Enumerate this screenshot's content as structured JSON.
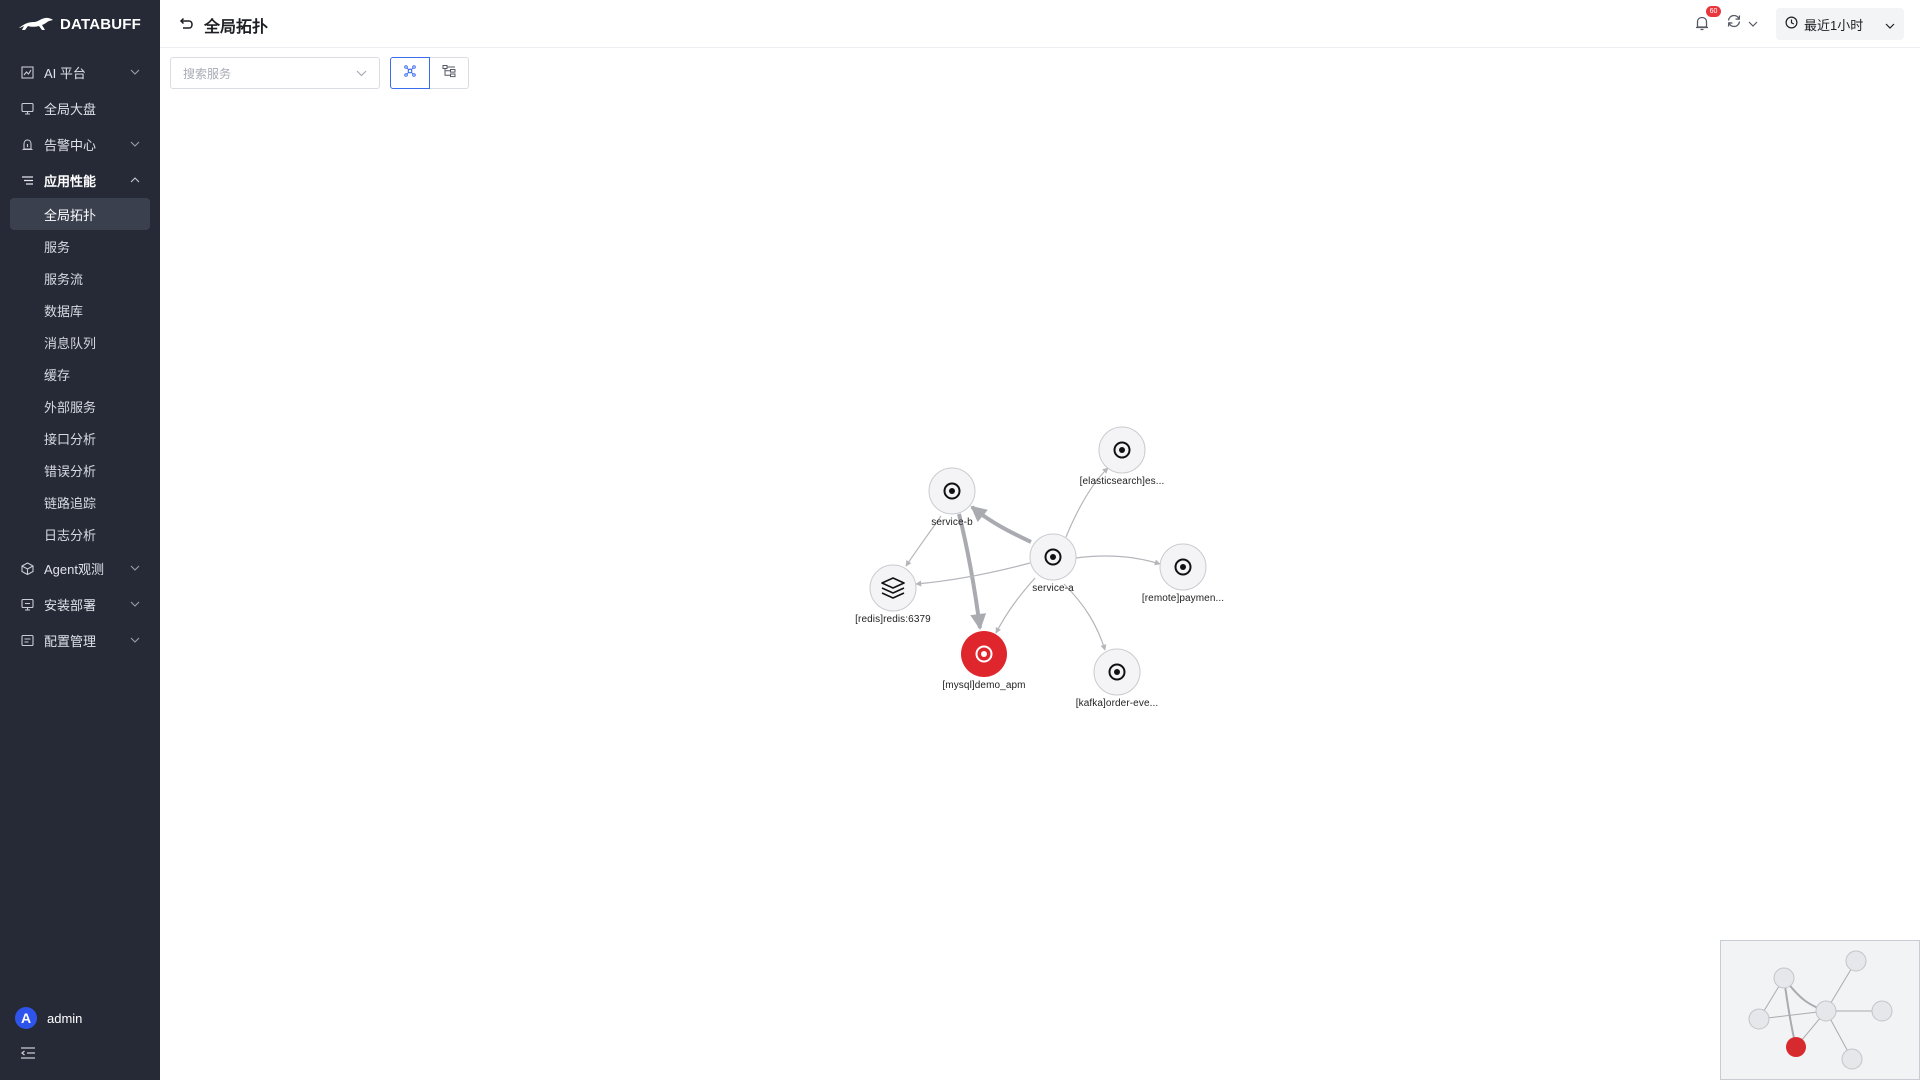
{
  "app": {
    "brand": "DATABUFF"
  },
  "sidebar": {
    "groups": [
      {
        "label": "AI 平台",
        "icon": "chart-icon",
        "expanded": false
      },
      {
        "label": "全局大盘",
        "icon": "monitor-icon",
        "expanded": null
      },
      {
        "label": "告警中心",
        "icon": "alarm-icon",
        "expanded": false
      },
      {
        "label": "应用性能",
        "icon": "list-icon",
        "expanded": true
      },
      {
        "label": "Agent观测",
        "icon": "cube-icon",
        "expanded": false
      },
      {
        "label": "安装部署",
        "icon": "monitor-icon",
        "expanded": false
      },
      {
        "label": "配置管理",
        "icon": "settings-panel-icon",
        "expanded": false
      }
    ],
    "apm_items": [
      "全局拓扑",
      "服务",
      "服务流",
      "数据库",
      "消息队列",
      "缓存",
      "外部服务",
      "接口分析",
      "错误分析",
      "链路追踪",
      "日志分析"
    ],
    "active_item": "全局拓扑",
    "user": {
      "avatar_letter": "A",
      "name": "admin"
    }
  },
  "header": {
    "title": "全局拓扑",
    "notification_count": "60",
    "time_range": "最近1小时"
  },
  "toolbar": {
    "search_placeholder": "搜索服务"
  },
  "topology": {
    "nodes": [
      {
        "id": "service-b",
        "label": "service-b",
        "icon": "target-icon",
        "status": "normal"
      },
      {
        "id": "elasticsearch",
        "label": "[elasticsearch]es...",
        "icon": "target-icon",
        "status": "normal"
      },
      {
        "id": "service-a",
        "label": "service-a",
        "icon": "target-icon",
        "status": "normal"
      },
      {
        "id": "remote",
        "label": "[remote]paymen...",
        "icon": "target-icon",
        "status": "normal"
      },
      {
        "id": "redis",
        "label": "[redis]redis:6379",
        "icon": "layers-icon",
        "status": "normal"
      },
      {
        "id": "mysql",
        "label": "[mysql]demo_apm",
        "icon": "target-icon",
        "status": "error"
      },
      {
        "id": "kafka",
        "label": "[kafka]order-eve...",
        "icon": "target-icon",
        "status": "normal"
      }
    ],
    "edges": [
      {
        "from": "service-a",
        "to": "service-b",
        "weight": "heavy"
      },
      {
        "from": "service-b",
        "to": "mysql",
        "weight": "heavy"
      },
      {
        "from": "service-b",
        "to": "redis",
        "weight": "light"
      },
      {
        "from": "service-a",
        "to": "elasticsearch",
        "weight": "light"
      },
      {
        "from": "service-a",
        "to": "remote",
        "weight": "light"
      },
      {
        "from": "service-a",
        "to": "redis",
        "weight": "light"
      },
      {
        "from": "service-a",
        "to": "mysql",
        "weight": "light"
      },
      {
        "from": "service-a",
        "to": "kafka",
        "weight": "light"
      }
    ]
  },
  "colors": {
    "sidebar_bg": "#252a36",
    "active_item_bg": "#3a404d",
    "accent": "#3b6cf0",
    "error_node": "#e0262d",
    "node_fill": "#f4f4f6",
    "edge": "#b4b6bb"
  }
}
